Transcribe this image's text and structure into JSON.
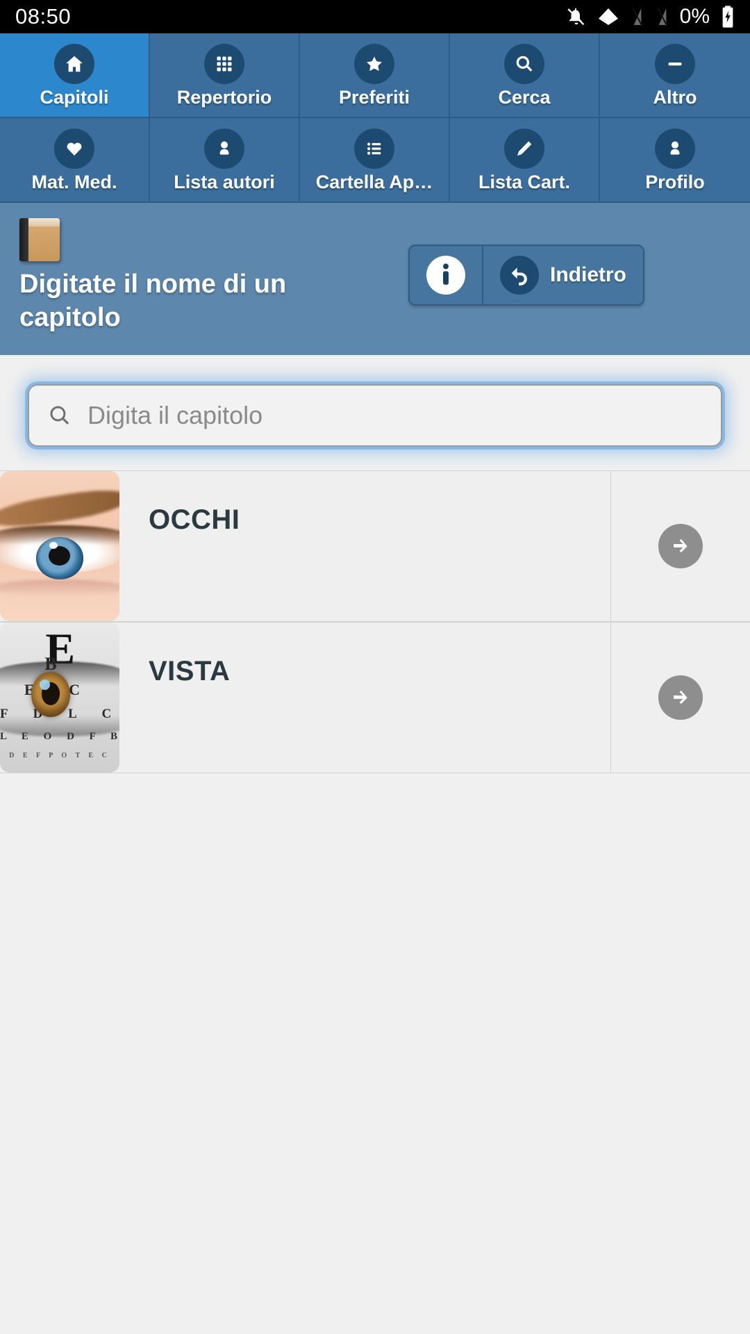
{
  "status_bar": {
    "time": "08:50",
    "battery_percent": "0%",
    "icons": [
      "bell-off-icon",
      "wifi-icon",
      "signal-off-icon",
      "signal-off-icon",
      "battery-charging-icon"
    ]
  },
  "nav": {
    "items": [
      {
        "label": "Capitoli",
        "icon": "home-icon",
        "active": true
      },
      {
        "label": "Repertorio",
        "icon": "grid-icon",
        "active": false
      },
      {
        "label": "Preferiti",
        "icon": "star-icon",
        "active": false
      },
      {
        "label": "Cerca",
        "icon": "search-icon",
        "active": false
      },
      {
        "label": "Altro",
        "icon": "minus-icon",
        "active": false
      },
      {
        "label": "Mat. Med.",
        "icon": "heart-icon",
        "active": false
      },
      {
        "label": "Lista autori",
        "icon": "person-icon",
        "active": false
      },
      {
        "label": "Cartella Ap…",
        "icon": "list-icon",
        "active": false
      },
      {
        "label": "Lista Cart.",
        "icon": "pencil-icon",
        "active": false
      },
      {
        "label": "Profilo",
        "icon": "person-icon",
        "active": false
      }
    ]
  },
  "header": {
    "icon": "book-icon",
    "title": "Digitate il nome di un capitolo",
    "info_button": {
      "icon": "info-icon",
      "label": ""
    },
    "back_button": {
      "icon": "back-arrow-icon",
      "label": "Indietro"
    }
  },
  "search": {
    "icon": "search-icon",
    "placeholder": "Digita il capitolo",
    "value": ""
  },
  "list": {
    "rows": [
      {
        "label": "OCCHI",
        "thumb": "eye-photo",
        "arrow": "arrow-right-icon"
      },
      {
        "label": "VISTA",
        "thumb": "eye-chart-photo",
        "arrow": "arrow-right-icon"
      }
    ]
  },
  "colors": {
    "nav_bg": "#3b6e9c",
    "nav_active": "#2d87cc",
    "nav_icon_circle": "#1d4a71",
    "header_bg": "#5d87ad",
    "page_bg": "#f0f0f0",
    "row_bg": "#efefef",
    "arrow_circle": "#8e8e8e",
    "focus_glow": "#5aa0e1",
    "label_text": "#2b3a41"
  }
}
